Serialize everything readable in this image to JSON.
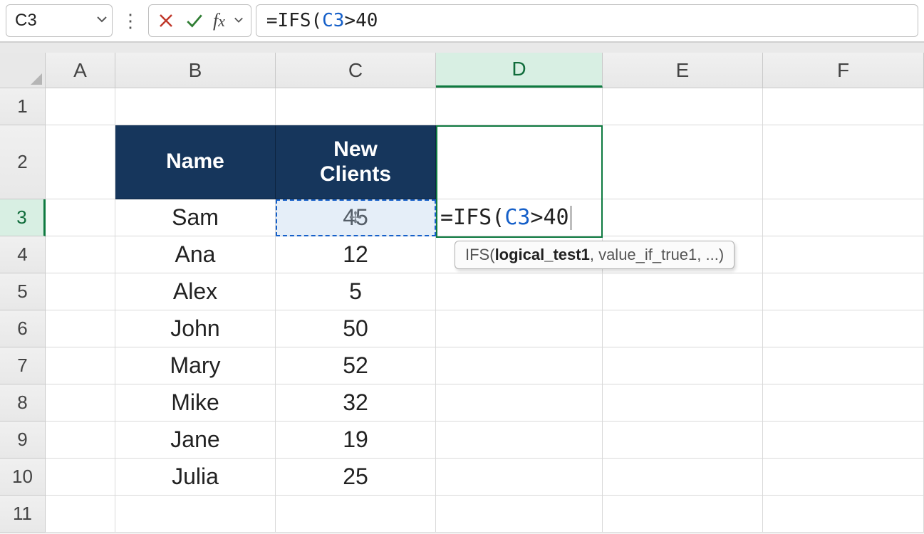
{
  "formula_bar": {
    "name_box": "C3",
    "formula_text_prefix": "=IFS(",
    "formula_text_ref": "C3",
    "formula_text_suffix": ">40"
  },
  "columns": [
    "A",
    "B",
    "C",
    "D",
    "E",
    "F"
  ],
  "rows": [
    "1",
    "2",
    "3",
    "4",
    "5",
    "6",
    "7",
    "8",
    "9",
    "10",
    "11"
  ],
  "headers": {
    "name": "Name",
    "clients_l1": "New",
    "clients_l2": "Clients"
  },
  "data_rows": [
    {
      "name": "Sam",
      "clients": "45"
    },
    {
      "name": "Ana",
      "clients": "12"
    },
    {
      "name": "Alex",
      "clients": "5"
    },
    {
      "name": "John",
      "clients": "50"
    },
    {
      "name": "Mary",
      "clients": "52"
    },
    {
      "name": "Mike",
      "clients": "32"
    },
    {
      "name": "Jane",
      "clients": "19"
    },
    {
      "name": "Julia",
      "clients": "25"
    }
  ],
  "editing_cell": {
    "prefix": "=IFS(",
    "ref": "C3",
    "suffix": ">40"
  },
  "tooltip": {
    "fn": "IFS(",
    "arg_bold": "logical_test1",
    "rest": ", value_if_true1, ...)"
  },
  "active_column": "D",
  "active_row": "3",
  "cursor_plus": "✢"
}
